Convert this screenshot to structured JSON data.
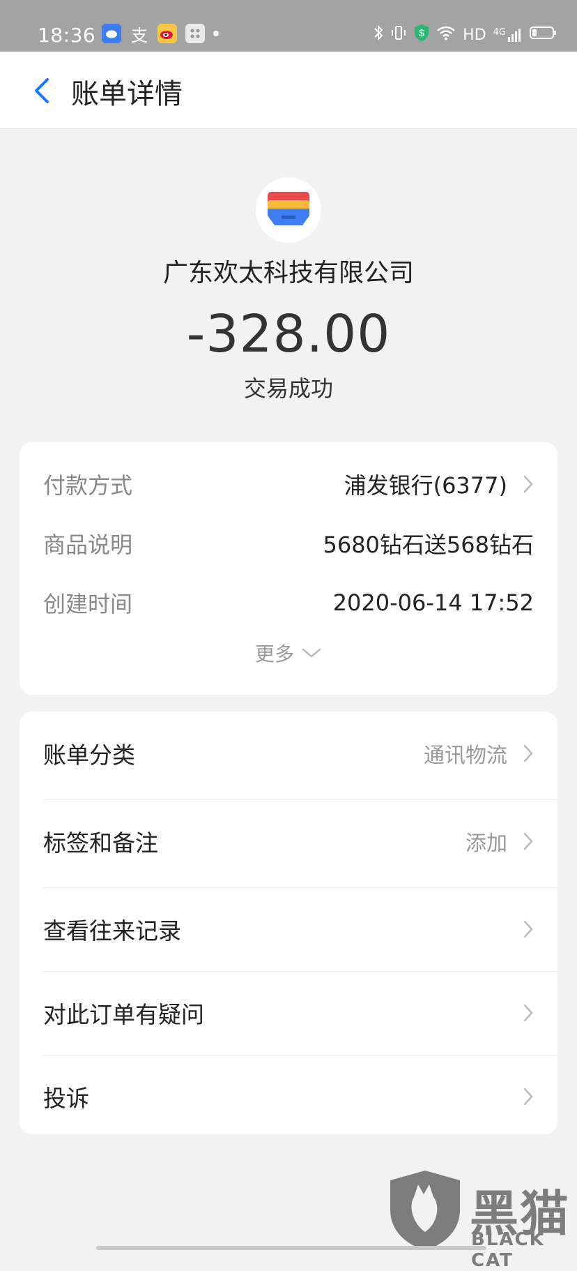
{
  "status_bar": {
    "time": "18:36",
    "network": "HD",
    "cellular": "4G"
  },
  "header": {
    "title": "账单详情"
  },
  "summary": {
    "merchant": "广东欢太科技有限公司",
    "amount": "-328.00",
    "status": "交易成功"
  },
  "details": {
    "rows": [
      {
        "label": "付款方式",
        "value": "浦发银行(6377)"
      },
      {
        "label": "商品说明",
        "value": "5680钻石送568钻石"
      },
      {
        "label": "创建时间",
        "value": "2020-06-14 17:52"
      }
    ],
    "more_label": "更多"
  },
  "menu": [
    {
      "label": "账单分类",
      "value": "通讯物流"
    },
    {
      "label": "标签和备注",
      "value": "添加"
    },
    {
      "label": "查看往来记录",
      "value": ""
    },
    {
      "label": "对此订单有疑问",
      "value": ""
    },
    {
      "label": "投诉",
      "value": ""
    }
  ],
  "watermark": {
    "brand": "黑猫",
    "sub": "BLACK CAT"
  },
  "colors": {
    "accent": "#1677ff",
    "status_bar": "#a3a3a3",
    "background": "#f2f2f2"
  }
}
